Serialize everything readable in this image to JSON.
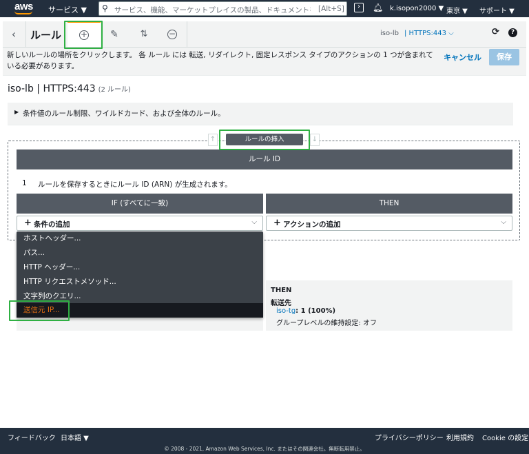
{
  "topnav": {
    "logo": "aws",
    "services": "サービス ▼",
    "search_placeholder": "サービス、機能、マーケットプレイスの製品、ドキュメントを検索",
    "search_shortcut": "[Alt+S]",
    "user": "k.isopon2000 ▼",
    "region": "東京 ▼",
    "support": "サポート ▼"
  },
  "toolbar": {
    "back_icon": "‹",
    "title": "ルール",
    "insert_icon": "+",
    "edit_icon": "✎",
    "reorder_icon": "⇅",
    "delete_icon": "−",
    "lb_name": "iso-lb",
    "listener": "| HTTPS:443 ⌵",
    "refresh_icon": "⟳",
    "help_icon": "?"
  },
  "infobar": {
    "text": "新しいルールの場所をクリックします。 各 ルール には 転送, リダイレクト, 固定レスポンス タイプのアクションの 1 つが含まれている必要があります。",
    "cancel": "キャンセル",
    "save": "保存"
  },
  "heading": {
    "title": "iso-lb | HTTPS:443",
    "count": "(2 ルール)"
  },
  "conditions_note": "条件値のルール制限、ワイルドカード、および全体のルール。",
  "insert": {
    "up": "↑",
    "label": "ルールの挿入",
    "down": "↓"
  },
  "rule": {
    "id_header": "ルール ID",
    "number": "1",
    "arn_note": "ルールを保存するときにルール ID (ARN) が生成されます。",
    "if_header": "IF (すべてに一致)",
    "then_header": "THEN",
    "add_condition": "条件の追加",
    "add_action": "アクションの追加"
  },
  "condition_options": [
    "ホストヘッダー...",
    "パス...",
    "HTTP ヘッダー...",
    "HTTP リクエストメソッド...",
    "文字列のクエリ...",
    "送信元 IP..."
  ],
  "selected_option": "送信元 IP...",
  "then_card": {
    "title": "THEN",
    "forward": "転送先",
    "target_link": "iso-tg",
    "target_rest": ": 1 (100%)",
    "stickiness": "グループレベルの維持設定: オフ"
  },
  "footer": {
    "feedback": "フィードバック",
    "language": "日本語 ▼",
    "privacy": "プライバシーポリシー",
    "terms": "利用規約",
    "cookie": "Cookie の設定",
    "copyright": "© 2008 - 2021, Amazon Web Services, Inc. またはその関連会社。無断転用禁止。"
  },
  "colors": {
    "nav_bg": "#232f3e",
    "accent_orange": "#ff9900",
    "link_blue": "#0073bb",
    "header_gray": "#545b64",
    "highlight_green": "#2fb043"
  }
}
